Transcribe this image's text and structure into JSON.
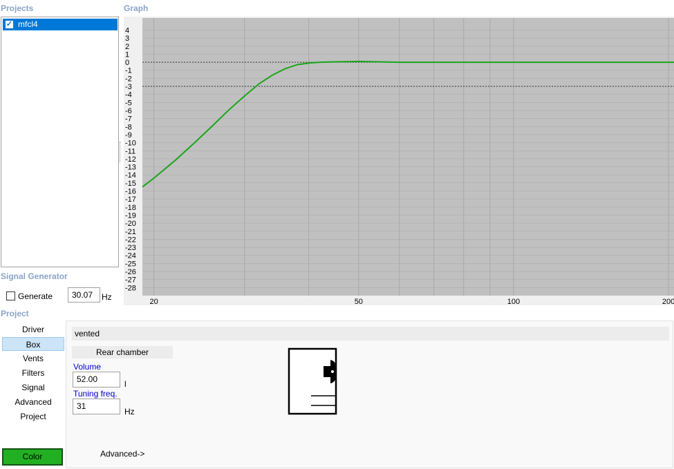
{
  "headers": {
    "projects": "Projects",
    "graph": "Graph",
    "signal_generator": "Signal Generator",
    "project": "Project"
  },
  "projects": [
    {
      "name": "mfcl4",
      "checked": true
    }
  ],
  "signal_generator": {
    "generate_label": "Generate",
    "generate_checked": false,
    "frequency": "30.07",
    "frequency_unit": "Hz"
  },
  "chart_data": {
    "type": "line",
    "x_scale": "log",
    "xlim": [
      19,
      205
    ],
    "ylim": [
      -29,
      5.5
    ],
    "y_ticks": [
      4,
      3,
      2,
      1,
      0,
      -1,
      -2,
      -3,
      -4,
      -5,
      -6,
      -7,
      -8,
      -9,
      -10,
      -11,
      -12,
      -13,
      -14,
      -15,
      -16,
      -17,
      -18,
      -19,
      -20,
      -21,
      -22,
      -23,
      -24,
      -25,
      -26,
      -27,
      -28
    ],
    "x_tick_labels": [
      20,
      50,
      100,
      200
    ],
    "x_gridlines": [
      20,
      30,
      40,
      50,
      60,
      70,
      80,
      90,
      100,
      200
    ],
    "reference_lines": [
      0,
      -3
    ],
    "grid": true,
    "colors": {
      "plot_bg": "#c0c0c0",
      "grid": "#a8a8a8",
      "curve": "#1aa51a",
      "reference": "#333333"
    },
    "series": [
      {
        "x": [
          19,
          20,
          22,
          24,
          26,
          28,
          30,
          32,
          34,
          36,
          38,
          40,
          42,
          45,
          50,
          60,
          80,
          100,
          150,
          205
        ],
        "y": [
          -15.5,
          -14.4,
          -12.2,
          -10.0,
          -7.9,
          -5.9,
          -4.2,
          -2.7,
          -1.6,
          -0.8,
          -0.3,
          -0.1,
          0.0,
          0.05,
          0.1,
          0.0,
          0.0,
          0.0,
          0.0,
          0.0
        ]
      }
    ]
  },
  "nav": {
    "items": [
      "Driver",
      "Box",
      "Vents",
      "Filters",
      "Signal",
      "Advanced",
      "Project"
    ],
    "active": "Box",
    "color_button": "Color",
    "color_value": "#22b022"
  },
  "box": {
    "type": "vented",
    "chamber_label": "Rear chamber",
    "volume_label": "Volume",
    "volume_value": "52.00",
    "volume_unit": "l",
    "tuning_label": "Tuning freq.",
    "tuning_value": "31",
    "tuning_unit": "Hz",
    "advanced_link": "Advanced->"
  }
}
